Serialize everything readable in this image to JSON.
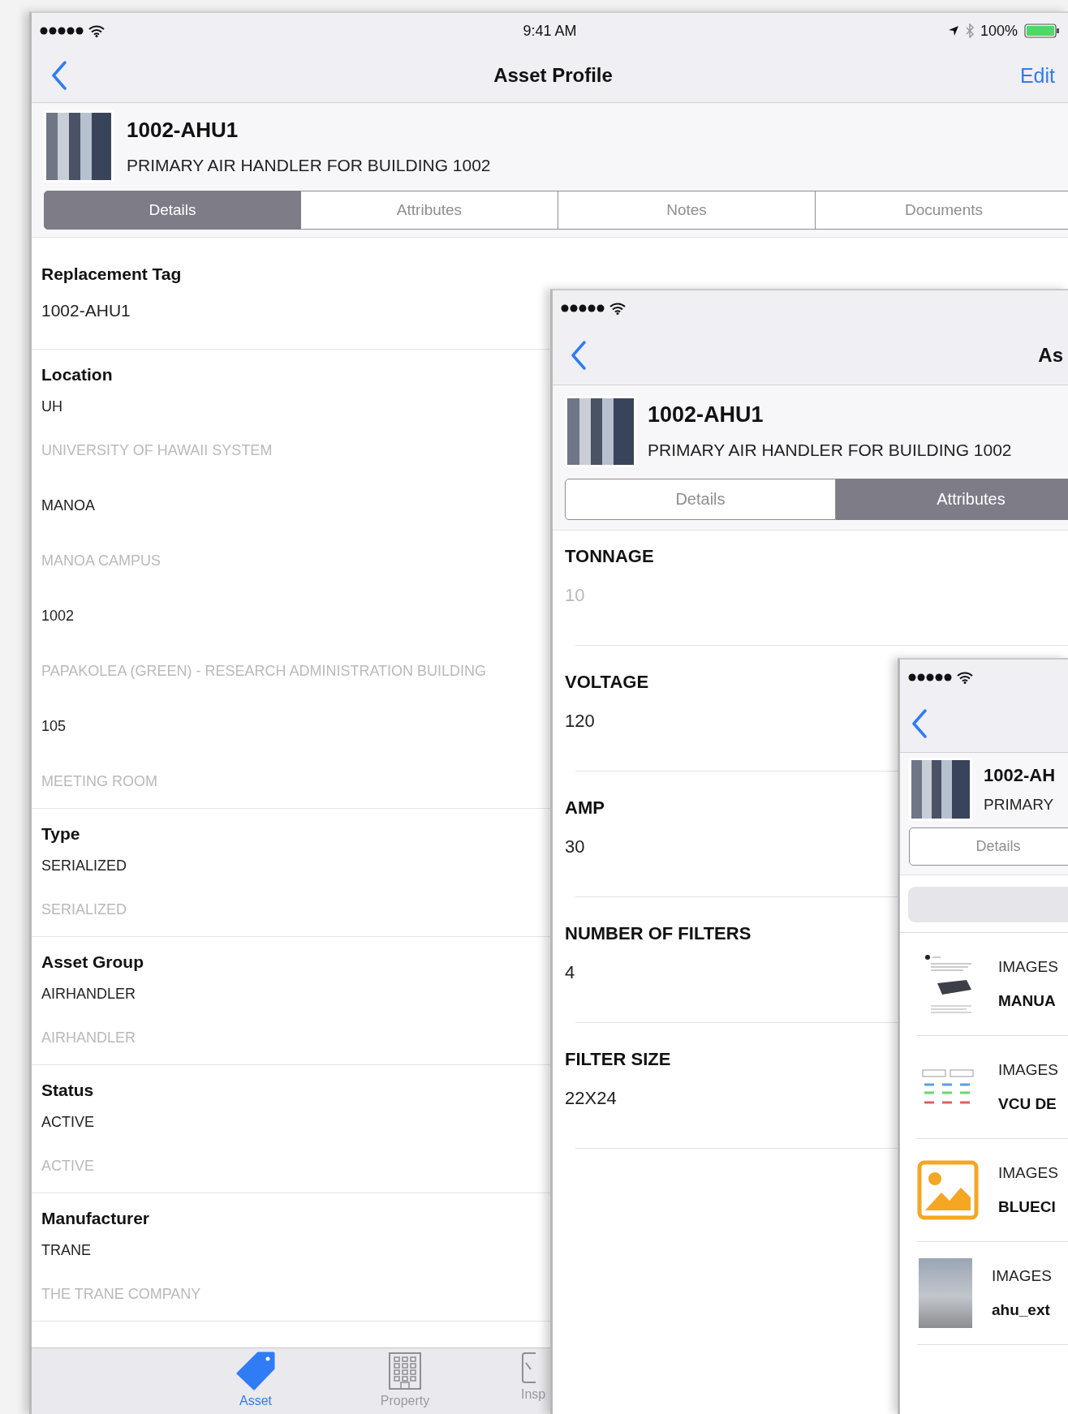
{
  "main_screen": {
    "status_bar": {
      "time": "9:41 AM",
      "battery": "100%"
    },
    "nav": {
      "title": "Asset Profile",
      "action": "Edit"
    },
    "asset": {
      "tag": "1002-AHU1",
      "description": "PRIMARY AIR HANDLER FOR BUILDING 1002"
    },
    "tabs": [
      {
        "label": "Details",
        "selected": true
      },
      {
        "label": "Attributes",
        "selected": false
      },
      {
        "label": "Notes",
        "selected": false
      },
      {
        "label": "Documents",
        "selected": false
      }
    ],
    "sections": [
      {
        "label": "Replacement Tag",
        "values": [
          {
            "text": "1002-AHU1",
            "muted": false
          }
        ]
      },
      {
        "label": "Location",
        "values": [
          {
            "text": "UH",
            "muted": false
          },
          {
            "text": "UNIVERSITY OF HAWAII SYSTEM",
            "muted": true
          },
          {
            "text": "MANOA",
            "muted": false
          },
          {
            "text": "MANOA CAMPUS",
            "muted": true
          },
          {
            "text": "1002",
            "muted": false
          },
          {
            "text": "PAPAKOLEA (GREEN) - RESEARCH ADMINISTRATION BUILDING",
            "muted": true
          },
          {
            "text": "105",
            "muted": false
          },
          {
            "text": "MEETING ROOM",
            "muted": true
          }
        ]
      },
      {
        "label": "Type",
        "values": [
          {
            "text": "SERIALIZED",
            "muted": false
          },
          {
            "text": "SERIALIZED",
            "muted": true
          }
        ]
      },
      {
        "label": "Asset Group",
        "values": [
          {
            "text": "AIRHANDLER",
            "muted": false
          },
          {
            "text": "AIRHANDLER",
            "muted": true
          }
        ]
      },
      {
        "label": "Status",
        "values": [
          {
            "text": "ACTIVE",
            "muted": false
          },
          {
            "text": "ACTIVE",
            "muted": true
          }
        ]
      },
      {
        "label": "Manufacturer",
        "values": [
          {
            "text": "TRANE",
            "muted": false
          },
          {
            "text": "THE TRANE COMPANY",
            "muted": true
          }
        ]
      }
    ],
    "tab_bar": [
      {
        "label": "Asset",
        "kind": "tag",
        "selected": true
      },
      {
        "label": "Property",
        "kind": "building",
        "selected": false
      },
      {
        "label": "Insp",
        "kind": "clipboard",
        "selected": false
      }
    ]
  },
  "attributes_screen": {
    "nav": {
      "title": "As"
    },
    "asset": {
      "tag": "1002-AHU1",
      "description": "PRIMARY AIR HANDLER FOR BUILDING 1002"
    },
    "tabs": [
      {
        "label": "Details",
        "selected": false
      },
      {
        "label": "Attributes",
        "selected": true
      }
    ],
    "attributes": [
      {
        "label": "TONNAGE",
        "value": "10",
        "muted": true
      },
      {
        "label": "VOLTAGE",
        "value": "120",
        "muted": false
      },
      {
        "label": "AMP",
        "value": "30",
        "muted": false
      },
      {
        "label": "NUMBER OF FILTERS",
        "value": "4",
        "muted": false
      },
      {
        "label": "FILTER SIZE",
        "value": "22X24",
        "muted": false
      }
    ]
  },
  "documents_screen": {
    "asset": {
      "tag": "1002-AH",
      "description": "PRIMARY"
    },
    "tabs": [
      {
        "label": "Details",
        "selected": false
      }
    ],
    "documents": [
      {
        "category": "IMAGES",
        "name": "MANUA",
        "kind": "manual"
      },
      {
        "category": "IMAGES",
        "name": "VCU DE",
        "kind": "diagram"
      },
      {
        "category": "IMAGES",
        "name": "BLUECI",
        "kind": "image"
      },
      {
        "category": "IMAGES",
        "name": "ahu_ext",
        "kind": "photo"
      }
    ]
  }
}
